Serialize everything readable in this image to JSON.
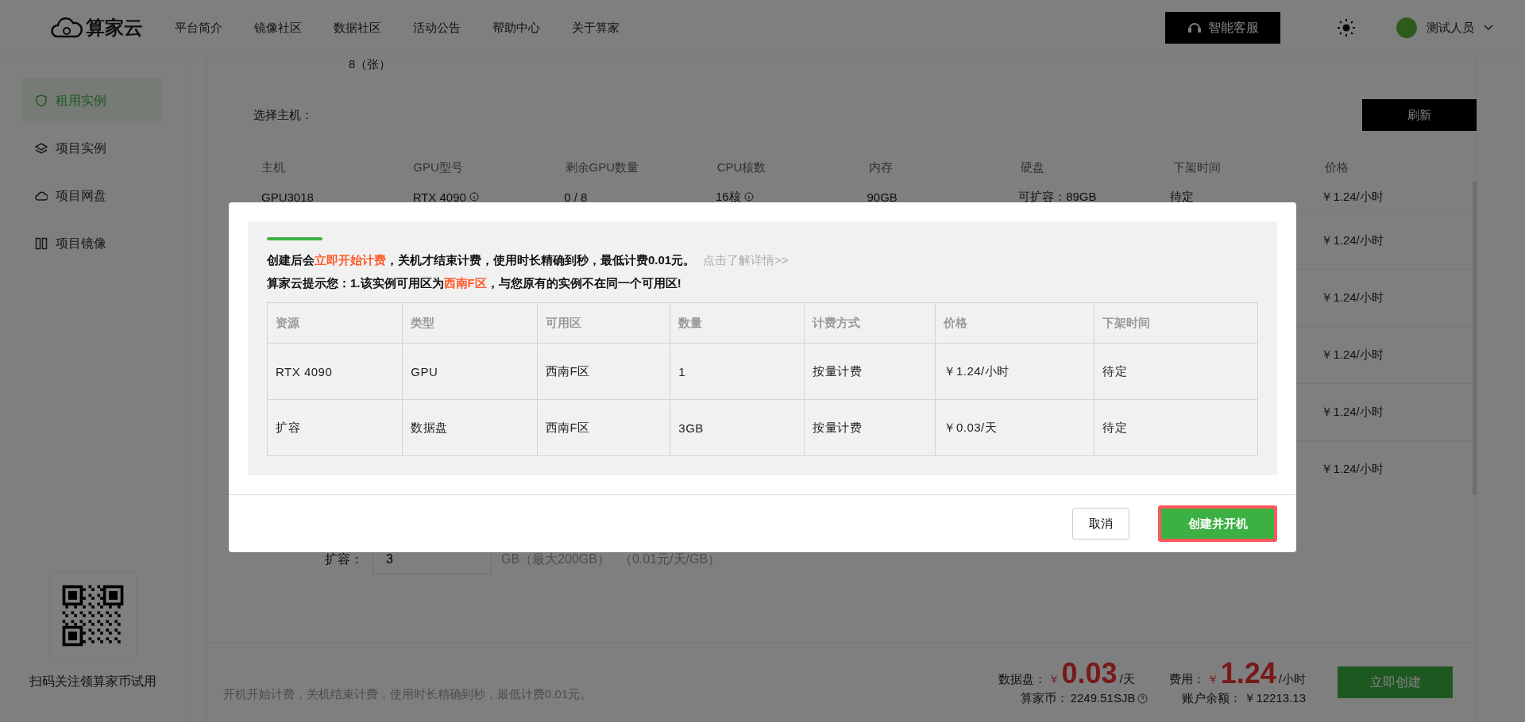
{
  "header": {
    "logo": "算家云",
    "nav": [
      {
        "label": "平台简介"
      },
      {
        "label": "镜像社区"
      },
      {
        "label": "数据社区"
      },
      {
        "label": "活动公告"
      },
      {
        "label": "帮助中心"
      },
      {
        "label": "关于算家"
      }
    ],
    "service_button": "智能客服",
    "user": "测试人员"
  },
  "sidebar": {
    "items": [
      {
        "label": "租用实例",
        "selected": true,
        "kind": "shield"
      },
      {
        "label": "项目实例",
        "selected": false,
        "kind": "layers"
      },
      {
        "label": "项目网盘",
        "selected": false,
        "kind": "cloud"
      },
      {
        "label": "项目镜像",
        "selected": false,
        "kind": "grid"
      }
    ],
    "qr_caption": "扫码关注领算家币试用"
  },
  "gpu_count": "8（张）",
  "host_label": "选择主机：",
  "refresh_button": "刷新",
  "host_table": {
    "columns": [
      "主机",
      "GPU型号",
      "剩余GPU数量",
      "CPU核数",
      "内存",
      "硬盘",
      "下架时间",
      "价格"
    ],
    "rows": [
      {
        "cells": [
          "GPU3018",
          "RTX 4090",
          "0 / 8",
          "16核",
          "90GB",
          "可扩容：89GB",
          "待定",
          "￥1.24/小时"
        ]
      },
      {
        "price": "￥1.24/小时"
      },
      {
        "price": "￥1.24/小时"
      },
      {
        "price": "￥1.24/小时"
      },
      {
        "price": "￥1.24/小时"
      },
      {
        "price": "￥1.24/小时"
      }
    ]
  },
  "expand": {
    "label": "扩容：",
    "value": "3",
    "unit": "GB（最大200GB）",
    "rate": "（0.01元/天/GB）"
  },
  "footer": {
    "notice": "开机开始计费，关机结束计费，使用时长精确到秒，最低计费0.01元。",
    "disk_label": "数据盘：",
    "disk_currency": "￥",
    "disk_price": "0.03",
    "disk_unit": "/天",
    "fee_label": "费用：",
    "fee_currency": "￥",
    "fee_price": "1.24",
    "fee_unit": "/小时",
    "coin_label": "算家币：",
    "coin_value": "2249.51SJB",
    "balance_label": "账户余额：",
    "balance_value": "￥12213.13",
    "create_button": "立即创建"
  },
  "dialog": {
    "line1": "创建后会**立即开始计费**，关机才结束计费，使用时长精确到秒，最低计费0.01元。",
    "details_link": "点击了解详情>>",
    "line2": "算家云提示您：1.该实例可用区为**西南F区**，与您原有的实例不在同一个可用区!",
    "columns": [
      "资源",
      "类型",
      "可用区",
      "数量",
      "计费方式",
      "价格",
      "下架时间"
    ],
    "rows": [
      [
        "RTX 4090",
        "GPU",
        "西南F区",
        "1",
        "按量计费",
        "￥1.24/小时",
        "待定"
      ],
      [
        "扩容",
        "数据盘",
        "西南F区",
        "3GB",
        "按量计费",
        "￥0.03/天",
        "待定"
      ]
    ],
    "cancel_button": "取消",
    "confirm_button": "创建并开机"
  }
}
